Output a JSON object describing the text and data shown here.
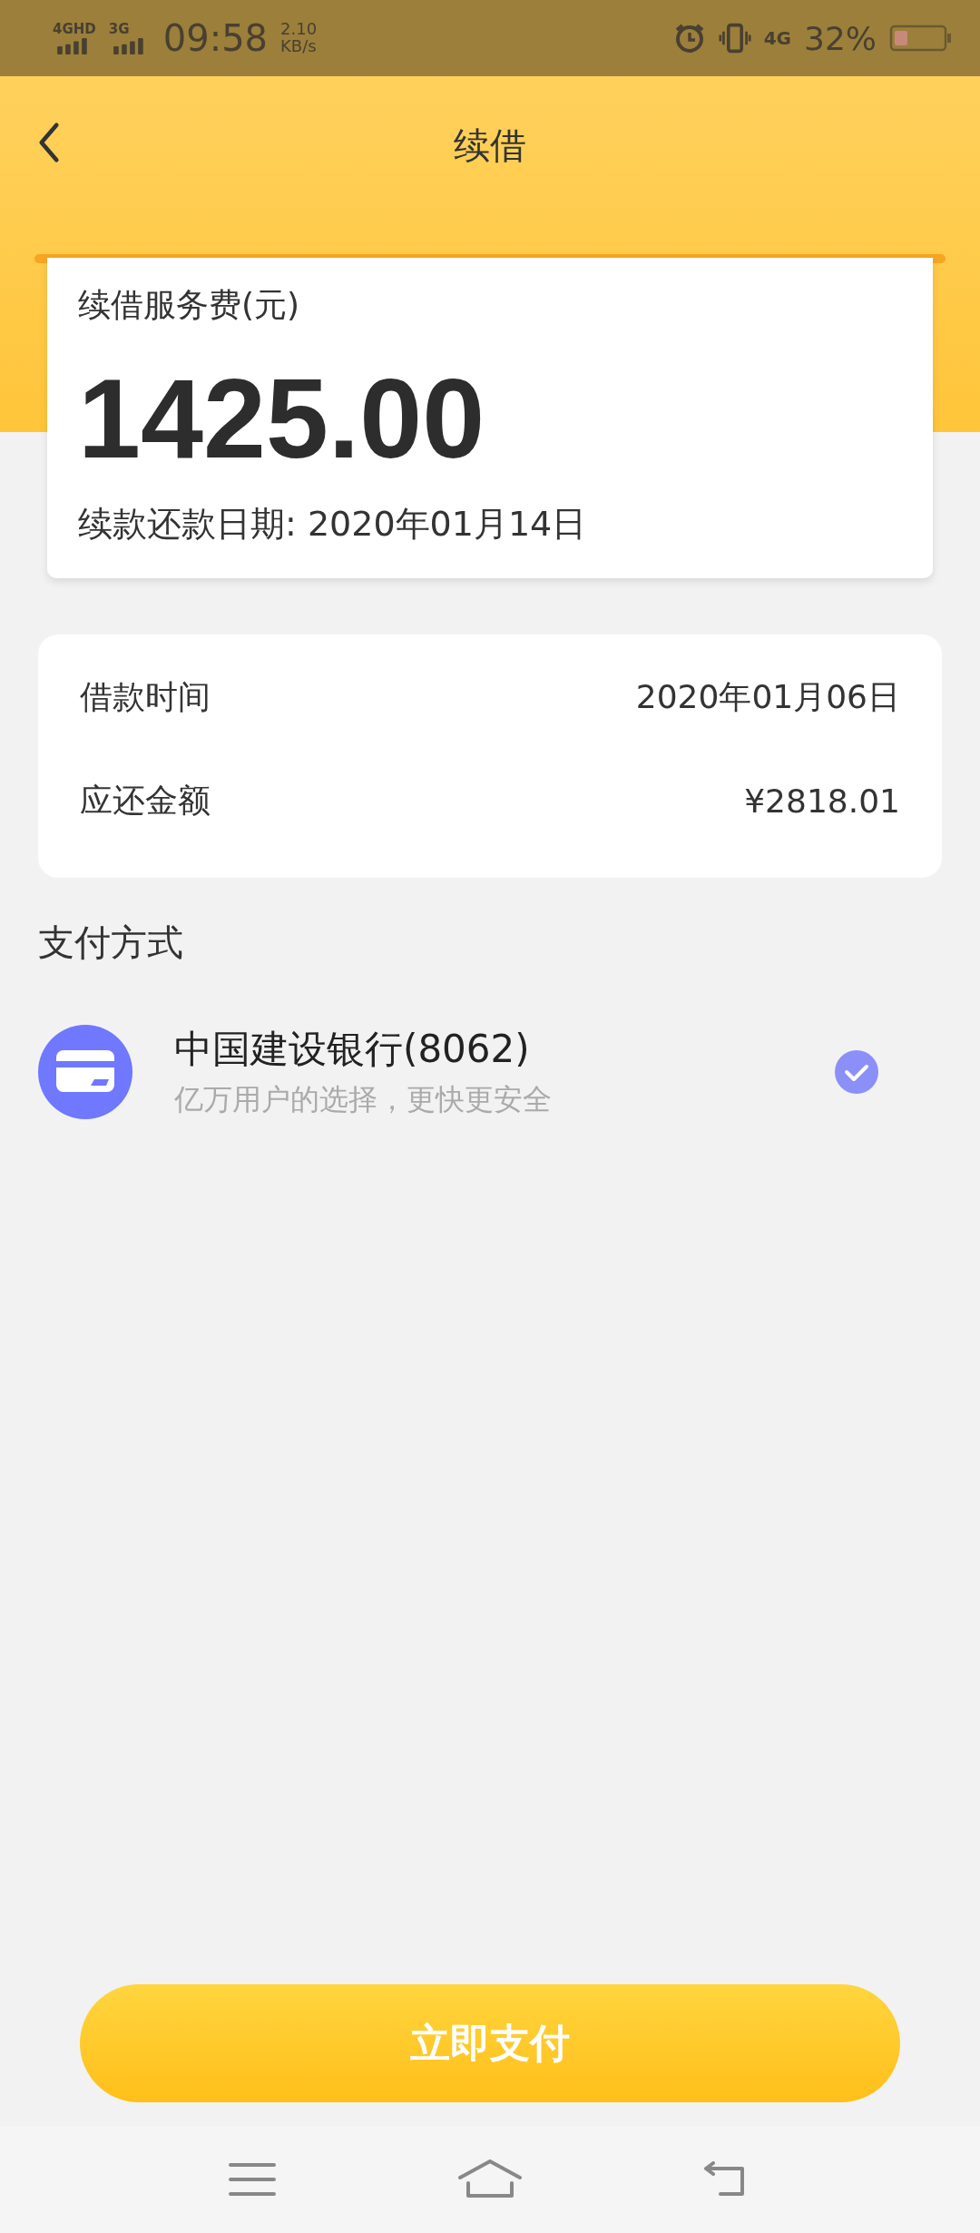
{
  "status_bar": {
    "sim1": "4GHD",
    "sim2": "3G",
    "time": "09:58",
    "speed_value": "2.10",
    "speed_unit": "KB/s",
    "network": "4G",
    "battery": "32%"
  },
  "header": {
    "title": "续借"
  },
  "fee_card": {
    "label": "续借服务费(元)",
    "amount": "1425.00",
    "due_date": "续款还款日期: 2020年01月14日"
  },
  "details": [
    {
      "label": "借款时间",
      "value": "2020年01月06日"
    },
    {
      "label": "应还金额",
      "value": "¥2818.01"
    }
  ],
  "payment_section": {
    "title": "支付方式"
  },
  "payment_methods": [
    {
      "name": "中国建设银行(8062)",
      "note": "亿万用户的选择，更快更安全",
      "selected": true
    }
  ],
  "pay_button": "立即支付"
}
